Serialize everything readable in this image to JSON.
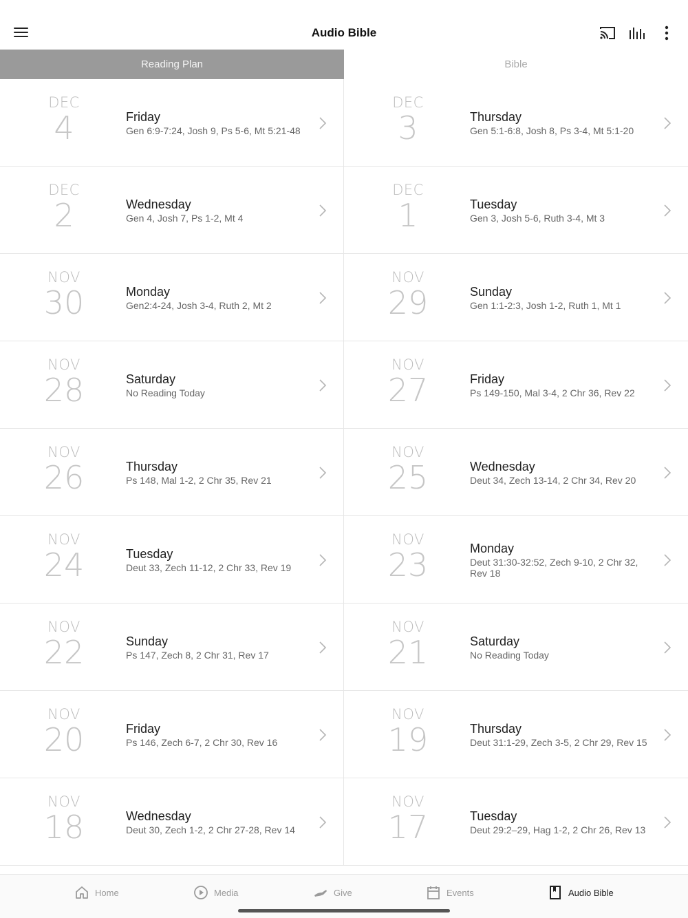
{
  "header": {
    "title": "Audio Bible"
  },
  "tabs": [
    {
      "label": "Reading Plan",
      "active": true
    },
    {
      "label": "Bible",
      "active": false
    }
  ],
  "readings": [
    {
      "month": "DEC",
      "day": "4",
      "weekday": "Friday",
      "refs": "Gen 6:9-7:24, Josh 9, Ps 5-6, Mt 5:21-48"
    },
    {
      "month": "DEC",
      "day": "3",
      "weekday": "Thursday",
      "refs": "Gen 5:1-6:8, Josh 8, Ps 3-4, Mt 5:1-20"
    },
    {
      "month": "DEC",
      "day": "2",
      "weekday": "Wednesday",
      "refs": "Gen 4, Josh 7, Ps 1-2, Mt 4"
    },
    {
      "month": "DEC",
      "day": "1",
      "weekday": "Tuesday",
      "refs": "Gen 3, Josh 5-6, Ruth 3-4, Mt 3"
    },
    {
      "month": "NOV",
      "day": "30",
      "weekday": "Monday",
      "refs": "Gen2:4-24, Josh 3-4, Ruth 2, Mt 2"
    },
    {
      "month": "NOV",
      "day": "29",
      "weekday": "Sunday",
      "refs": "Gen 1:1-2:3, Josh 1-2, Ruth 1, Mt 1"
    },
    {
      "month": "NOV",
      "day": "28",
      "weekday": "Saturday",
      "refs": "No Reading Today"
    },
    {
      "month": "NOV",
      "day": "27",
      "weekday": "Friday",
      "refs": "Ps 149-150, Mal 3-4, 2 Chr 36, Rev 22"
    },
    {
      "month": "NOV",
      "day": "26",
      "weekday": "Thursday",
      "refs": "Ps 148, Mal 1-2, 2 Chr 35, Rev 21"
    },
    {
      "month": "NOV",
      "day": "25",
      "weekday": "Wednesday",
      "refs": "Deut 34, Zech 13-14, 2 Chr 34, Rev 20"
    },
    {
      "month": "NOV",
      "day": "24",
      "weekday": "Tuesday",
      "refs": "Deut 33, Zech 11-12, 2 Chr 33, Rev 19"
    },
    {
      "month": "NOV",
      "day": "23",
      "weekday": "Monday",
      "refs": "Deut 31:30-32:52, Zech 9-10, 2 Chr 32, Rev 18"
    },
    {
      "month": "NOV",
      "day": "22",
      "weekday": "Sunday",
      "refs": "Ps 147, Zech 8, 2 Chr 31, Rev 17"
    },
    {
      "month": "NOV",
      "day": "21",
      "weekday": "Saturday",
      "refs": "No Reading Today"
    },
    {
      "month": "NOV",
      "day": "20",
      "weekday": "Friday",
      "refs": "Ps 146, Zech 6-7, 2 Chr 30, Rev 16"
    },
    {
      "month": "NOV",
      "day": "19",
      "weekday": "Thursday",
      "refs": "Deut 31:1-29, Zech 3-5, 2 Chr 29, Rev 15"
    },
    {
      "month": "NOV",
      "day": "18",
      "weekday": "Wednesday",
      "refs": "Deut 30, Zech 1-2, 2 Chr 27-28, Rev 14"
    },
    {
      "month": "NOV",
      "day": "17",
      "weekday": "Tuesday",
      "refs": "Deut 29:2–29, Hag 1-2, 2 Chr 26, Rev 13"
    }
  ],
  "bottom_nav": [
    {
      "label": "Home",
      "icon": "home-icon",
      "active": false
    },
    {
      "label": "Media",
      "icon": "play-circle-icon",
      "active": false
    },
    {
      "label": "Give",
      "icon": "give-hand-icon",
      "active": false
    },
    {
      "label": "Events",
      "icon": "calendar-icon",
      "active": false
    },
    {
      "label": "Audio Bible",
      "icon": "book-icon",
      "active": true
    }
  ],
  "colors": {
    "tab_active_bg": "#9a9a9a",
    "date_text": "#bdbdbd",
    "nav_active": "#222222",
    "nav_inactive": "#9a9a9a"
  }
}
